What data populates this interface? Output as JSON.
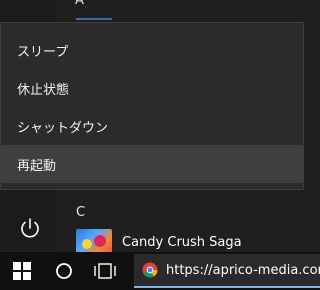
{
  "start_menu": {
    "section_a_letter": "A",
    "section_c_letter": "C",
    "apps": [
      {
        "name": "Candy Crush Saga",
        "icon": "candy-crush-icon"
      }
    ]
  },
  "power_menu": {
    "items": [
      {
        "label": "スリープ"
      },
      {
        "label": "休止状態"
      },
      {
        "label": "シャットダウン"
      },
      {
        "label": "再起動"
      }
    ],
    "hovered_index": 3
  },
  "taskbar": {
    "start_icon": "windows-logo-icon",
    "search_icon": "cortana-circle-icon",
    "taskview_icon": "task-view-icon",
    "chrome_window_title": "https://aprico-media.com"
  },
  "colors": {
    "menu_background": "#2b2b2b",
    "menu_hover": "#3f3f3f",
    "taskbar": "#101010",
    "accent": "#3a6ea5"
  }
}
